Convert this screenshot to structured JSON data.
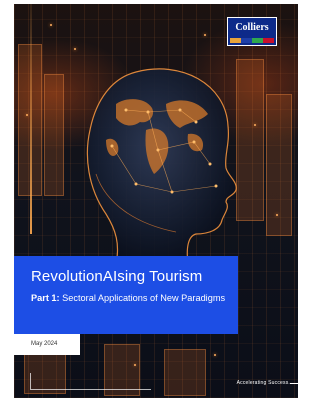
{
  "brand": {
    "logo_text": "Colliers",
    "stripe_colors": [
      "#e8a33b",
      "#1e3fa8",
      "#2fa84f",
      "#c8102e"
    ]
  },
  "cover": {
    "title": "RevolutionAIsing Tourism",
    "part_label": "Part 1:",
    "part_title": "Sectoral Applications of New Paradigms",
    "date": "May 2024",
    "tagline": "Accelerating Success."
  },
  "colors": {
    "title_box": "#1d4ee5",
    "accent_glow": "#ff8a30",
    "logo_bg": "#0d2a8a"
  }
}
